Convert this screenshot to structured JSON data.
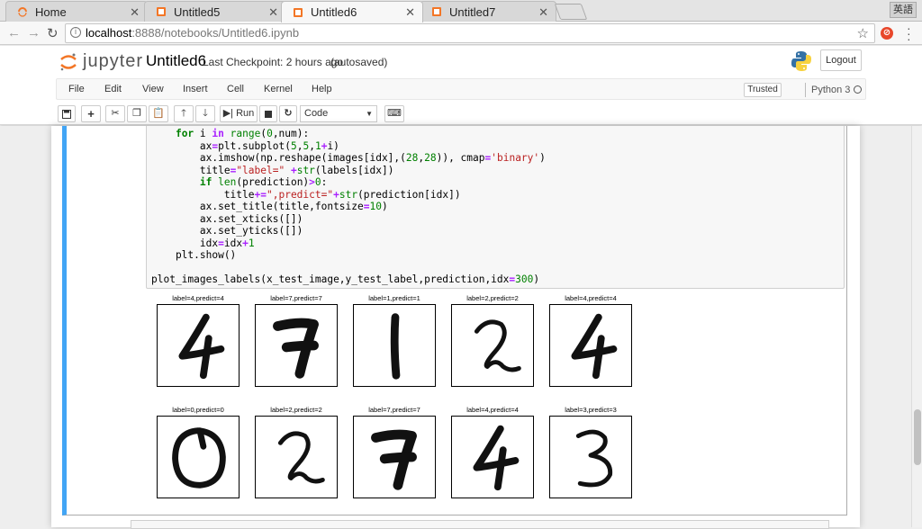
{
  "browser": {
    "tabs": [
      {
        "label": "Home",
        "icon": "jupyter-home-icon"
      },
      {
        "label": "Untitled5",
        "icon": "notebook-icon"
      },
      {
        "label": "Untitled6",
        "icon": "notebook-icon"
      },
      {
        "label": "Untitled7",
        "icon": "notebook-icon"
      }
    ],
    "ime_label": "英語",
    "url_host": "localhost",
    "url_path": ":8888/notebooks/Untitled6.ipynb"
  },
  "jupyter": {
    "logo_text": "jupyter",
    "notebook_name": "Untitled6",
    "checkpoint": "Last Checkpoint: 2 hours ago",
    "autosaved": "(autosaved)",
    "logout_label": "Logout",
    "menu": [
      "File",
      "Edit",
      "View",
      "Insert",
      "Cell",
      "Kernel",
      "Help"
    ],
    "trusted_label": "Trusted",
    "kernel_name": "Python 3",
    "cell_type": "Code",
    "run_label": "Run"
  },
  "code_lines": [
    "    for i in range(0,num):",
    "        ax=plt.subplot(5,5,1+i)",
    "        ax.imshow(np.reshape(images[idx],(28,28)), cmap='binary')",
    "        title=\"label=\" +str(labels[idx])",
    "        if len(prediction)>0:",
    "            title+=\",predict=\"+str(prediction[idx])",
    "        ax.set_title(title,fontsize=10)",
    "        ax.set_xticks([])",
    "        ax.set_yticks([])",
    "        idx=idx+1",
    "    plt.show()",
    "",
    "plot_images_labels(x_test_image,y_test_label,prediction,idx=300)"
  ],
  "subplots": [
    {
      "title": "label=4,predict=4",
      "digit": "4"
    },
    {
      "title": "label=7,predict=7",
      "digit": "7"
    },
    {
      "title": "label=1,predict=1",
      "digit": "1"
    },
    {
      "title": "label=2,predict=2",
      "digit": "2"
    },
    {
      "title": "label=4,predict=4",
      "digit": "4"
    },
    {
      "title": "label=0,predict=0",
      "digit": "0"
    },
    {
      "title": "label=2,predict=2",
      "digit": "2"
    },
    {
      "title": "label=7,predict=7",
      "digit": "7"
    },
    {
      "title": "label=4,predict=4",
      "digit": "4"
    },
    {
      "title": "label=3,predict=3",
      "digit": "3"
    }
  ]
}
